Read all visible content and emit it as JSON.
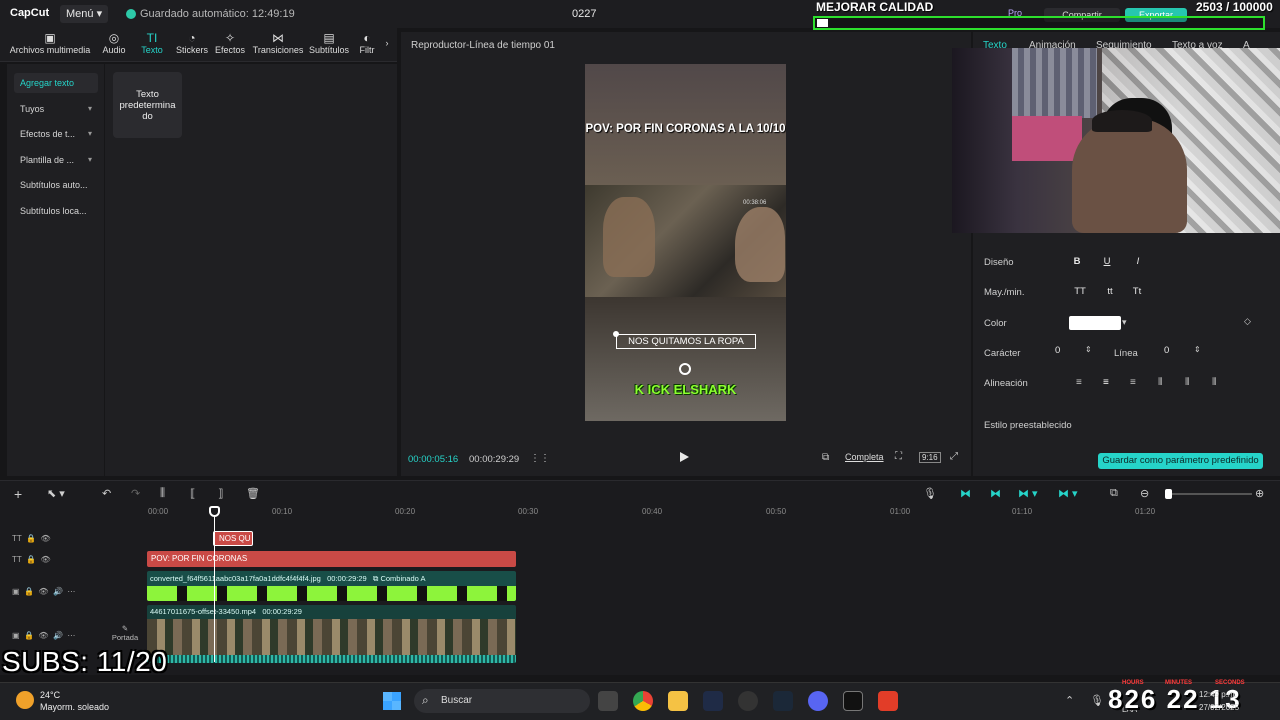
{
  "app": {
    "logo": "CapCut",
    "menu_label": "Menú",
    "autosave": "Guardado automático: 12:49:19",
    "project_name": "0227"
  },
  "tools": [
    {
      "label": "Archivos multimedia",
      "icon": "media-icon"
    },
    {
      "label": "Audio",
      "icon": "audio-icon"
    },
    {
      "label": "Texto",
      "icon": "text-icon"
    },
    {
      "label": "Stickers",
      "icon": "sticker-icon"
    },
    {
      "label": "Efectos",
      "icon": "effects-icon"
    },
    {
      "label": "Transiciones",
      "icon": "transition-icon"
    },
    {
      "label": "Subtítulos",
      "icon": "subtitles-icon"
    },
    {
      "label": "Filtr",
      "icon": "filter-icon"
    }
  ],
  "left_nav": {
    "items": [
      {
        "label": "Agregar texto"
      },
      {
        "label": "Tuyos"
      },
      {
        "label": "Efectos de t..."
      },
      {
        "label": "Plantilla de ..."
      },
      {
        "label": "Subtítulos auto..."
      },
      {
        "label": "Subtítulos loca..."
      }
    ],
    "preset_card": "Texto predetermina do"
  },
  "player": {
    "title": "Reproductor-Línea de tiempo 01",
    "video_title": "POV: POR FIN CORONAS A LA 10/10",
    "stamp": "00:38:06",
    "caption": "NOS QUITAMOS LA ROPA",
    "kick": "K ICK ELSHARK",
    "time_current": "00:00:05:16",
    "time_total": "00:00:29:29",
    "completa": "Completa",
    "ratio": "9:16"
  },
  "right_panel": {
    "tabs": [
      "Texto",
      "Animación",
      "Seguimiento",
      "Texto a voz",
      "A"
    ],
    "labels": {
      "design": "Diseño",
      "case": "May./min.",
      "color": "Color",
      "character": "Carácter",
      "line": "Línea",
      "alignment": "Alineación",
      "preset_style": "Estilo preestablecido"
    },
    "design_buttons": [
      "B",
      "U",
      "I"
    ],
    "case_buttons": [
      "TT",
      "tt",
      "Tt"
    ],
    "character_value": "0",
    "line_value": "0",
    "text_color": "#ffffff",
    "save_preset": "Guardar como parámetro predefinido"
  },
  "header_actions": {
    "pro": "Pro",
    "share": "Compartir",
    "export": "Exportar"
  },
  "stream_overlay": {
    "quality_label": "MEJORAR CALIDAD",
    "counter": "2503 / 100000",
    "progress_fraction": 0.025,
    "subs": "SUBS: 11/20",
    "clock_digits": "826 22 13",
    "clock_labels": [
      "HOURS",
      "MINUTES",
      "SECONDS"
    ]
  },
  "timeline": {
    "ruler": [
      "00:00",
      "00:10",
      "00:20",
      "00:30",
      "00:40",
      "00:50",
      "01:00",
      "01:10",
      "01:20"
    ],
    "clip_small": "NOS QU",
    "clip_pov": "POV: POR FIN CORONAS",
    "clip_image_label": "converted_f64f5611aabc03a17fa0a1ddfc4f4f4f4.jpg",
    "clip_image_duration": "00:00:29:29",
    "clip_image_combined": "Combinado A",
    "clip_video_label": "44617011675-offset-33450.mp4",
    "clip_video_duration": "00:00:29:29",
    "cover_label": "Portada"
  },
  "taskbar": {
    "temp": "24°C",
    "weather": "Mayorm. soleado",
    "search": "Buscar",
    "time": "12:49 p.m.",
    "date": "27/02/2025",
    "lang": "LAA"
  },
  "colors": {
    "accent": "#26d4c9",
    "clip_text": "#c94a46",
    "clip_media": "#184e48",
    "overlay_green": "#2de02d"
  }
}
